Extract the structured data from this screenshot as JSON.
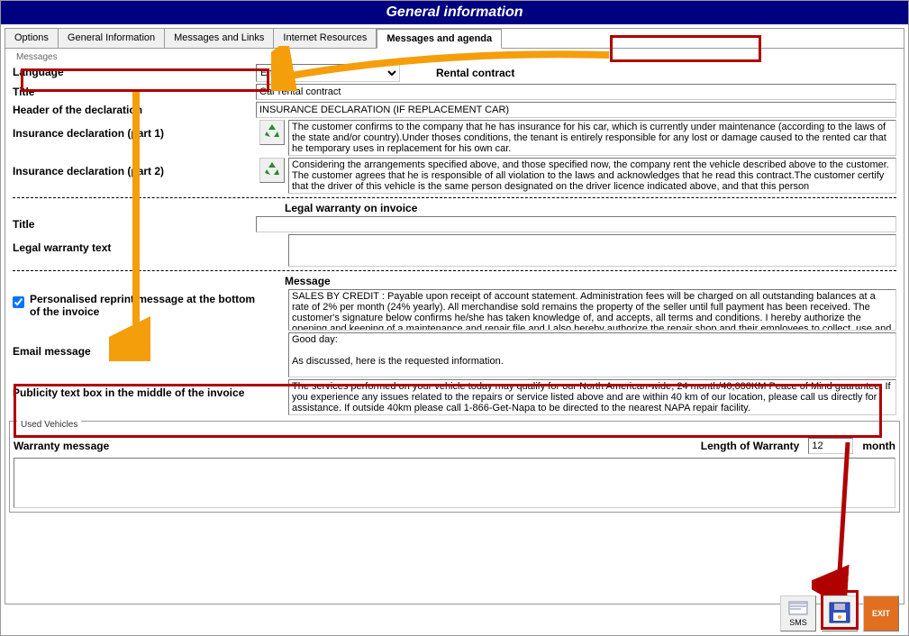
{
  "window": {
    "title": "General information"
  },
  "tabs": {
    "options": "Options",
    "general": "General Information",
    "messages_links": "Messages and Links",
    "internet": "Internet Resources",
    "messages_agenda": "Messages and agenda"
  },
  "messages": {
    "fieldset": "Messages",
    "language_label": "Language",
    "language_value": "English",
    "rental_contract_header": "Rental contract",
    "title_label": "Title",
    "title_value": "Car rental contract",
    "header_decl_label": "Header of the declaration",
    "header_decl_value": "INSURANCE DECLARATION (IF REPLACEMENT CAR)",
    "ins_decl1_label": "Insurance declaration (part 1)",
    "ins_decl1_value": "The customer confirms to the company that he has insurance for his car, which is currently under maintenance (according to the laws of the state and/or country).Under thoses conditions, the tenant is entirely responsible for any lost or damage caused to the rented car that he temporary uses in replacement for his own car.",
    "ins_decl2_label": "Insurance declaration (part 2)",
    "ins_decl2_value": "Considering the arrangements specified above, and those specified now, the company rent the vehicle described above to the customer. The customer agrees that he is responsible of all violation to the laws and acknowledges that he read this contract.The customer certify that the driver of this vehicle is the same person designated on the driver licence indicated above, and that this person"
  },
  "legal": {
    "section_header": "Legal warranty on invoice",
    "title_label": "Title",
    "title_value": "",
    "text_label": "Legal warranty text",
    "text_value": ""
  },
  "message_section": {
    "header": "Message",
    "personalised_label": "Personalised reprint message at the bottom of the invoice",
    "personalised_value": "SALES BY CREDIT : Payable upon receipt of account statement. Administration fees will be charged on all outstanding balances at a rate of 2% per month (24% yearly). All merchandise sold remains the property of the seller until full payment has been received. The customer's signature below confirms he/she has taken knowledge of, and accepts, all terms and conditions. I hereby authorize the opening and keeping of a maintenance and repair file and I also hereby authorize the repair shop and their employees to collect, use and",
    "email_label": "Email message",
    "email_value": "Good day:\n\nAs discussed, here is the requested information.",
    "publicity_label": "Publicity text box in the middle of the invoice",
    "publicity_value": "The services performed on your vehicle today may qualify for our North American-wide, 24 month/40,000KM Peace of Mind guarantee. If you experience any issues related to the repairs or service listed above and are within 40 km of our location, please call us directly for assistance. If outside 40km please call 1-866-Get-Napa to be directed to the nearest NAPA repair facility."
  },
  "used_vehicles": {
    "legend": "Used Vehicles",
    "warranty_label": "Warranty message",
    "length_label": "Length of Warranty",
    "length_value": "12",
    "length_unit": "month",
    "warranty_text": ""
  },
  "toolbar": {
    "sms": "SMS",
    "save": "Save",
    "exit": "EXIT"
  }
}
